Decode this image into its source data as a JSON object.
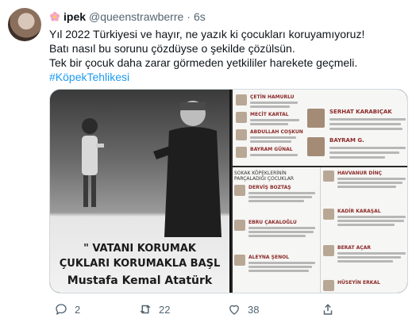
{
  "tweet": {
    "display_name": "ipek",
    "handle": "@queenstrawberre",
    "dot": "·",
    "time": "6s",
    "lines": [
      "Yıl 2022 Türkiyesi ve hayır, ne yazık ki çocukları koruyamıyoruz!",
      "Batı nasıl bu sorunu çözdüyse o şekilde çözülsün.",
      "Tek bir çocuk daha zarar görmeden yetkililer harekete geçmeli."
    ],
    "hashtag": "#KöpekTehlikesi"
  },
  "media": {
    "quote_line1": "\" VATANI KORUMAK",
    "quote_line2": "ÇUKLARI KORUMAKLA BAŞL",
    "quote_line3": "Mustafa Kemal Atatürk",
    "list_top": [
      {
        "name": "ÇETİN HAMURLU"
      },
      {
        "name": "MECİT KARTAL"
      },
      {
        "name": "ABDULLAH COŞKUN"
      },
      {
        "name": "BAYRAM GÜNAL"
      }
    ],
    "list_top_right": [
      {
        "name": "SERHAT KARABIÇAK"
      },
      {
        "name": "BAYRAM G."
      }
    ],
    "section_title": "SOKAK KÖPEKLERİNİN PARÇALADIĞI ÇOCUKLAR",
    "list_left": [
      {
        "name": "DERVİŞ BOZTAŞ"
      },
      {
        "name": "EBRU ÇAKALOĞLU"
      },
      {
        "name": "ALEYNA ŞENOL"
      }
    ],
    "list_right": [
      {
        "name": "HAVVANUR DİNÇ"
      },
      {
        "name": "KADİR KARAŞAL"
      },
      {
        "name": "BERAT AÇAR"
      },
      {
        "name": "HÜSEYİN ERKAL"
      }
    ]
  },
  "actions": {
    "reply_count": "2",
    "retweet_count": "22",
    "like_count": "38"
  },
  "colors": {
    "accent": "#1d9bf0",
    "muted": "#536471"
  }
}
